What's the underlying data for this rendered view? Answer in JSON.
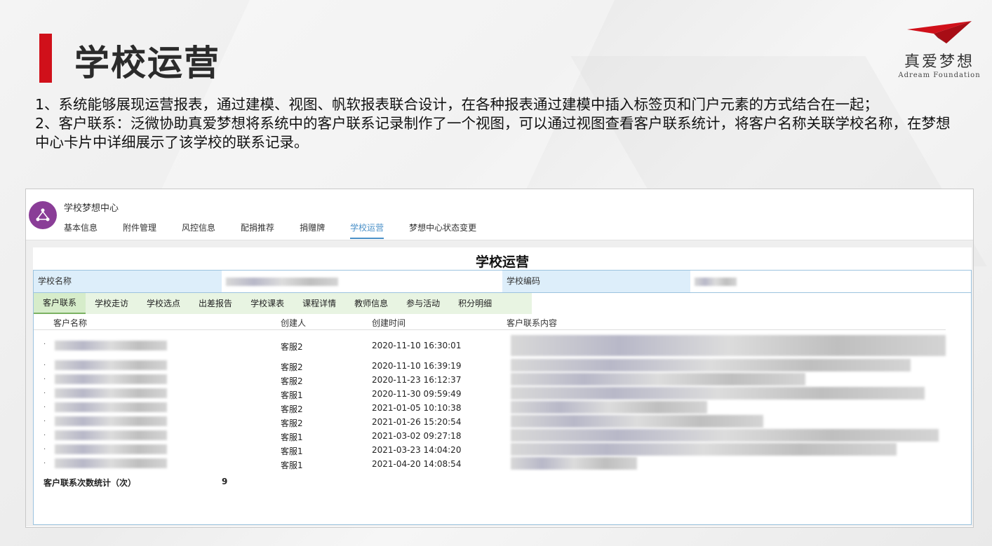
{
  "slide": {
    "title": "学校运营",
    "logo": {
      "cn": "真爱梦想",
      "en": "Adream Foundation"
    },
    "paragraphs": [
      "1、系统能够展现运营报表，通过建模、视图、帆软报表联合设计，在各种报表通过建模中插入标签页和门户元素的方式结合在一起；",
      "2、客户联系：泛微协助真爱梦想将系统中的客户联系记录制作了一个视图，可以通过视图查看客户联系统计，将客户名称关联学校名称，在梦想中心卡片中详细展示了该学校的联系记录。"
    ]
  },
  "app": {
    "title": "学校梦想中心",
    "icon": "share-network-icon",
    "accent": "#8a3d97",
    "nav": [
      "基本信息",
      "附件管理",
      "风控信息",
      "配捐推荐",
      "捐赠牌",
      "学校运营",
      "梦想中心状态变更"
    ],
    "nav_active": "学校运营"
  },
  "card": {
    "title": "学校运营",
    "school_name_label": "学校名称",
    "school_code_label": "学校编码",
    "tabs": [
      "客户联系",
      "学校走访",
      "学校选点",
      "出差报告",
      "学校课表",
      "课程详情",
      "教师信息",
      "参与活动",
      "积分明细"
    ],
    "tab_active": "客户联系",
    "columns": [
      "客户名称",
      "创建人",
      "创建时间",
      "客户联系内容"
    ],
    "rows": [
      {
        "creator": "客服2",
        "time": "2020-11-10 16:30:01"
      },
      {
        "creator": "客服2",
        "time": "2020-11-10 16:39:19"
      },
      {
        "creator": "客服2",
        "time": "2020-11-23 16:12:37"
      },
      {
        "creator": "客服1",
        "time": "2020-11-30 09:59:49"
      },
      {
        "creator": "客服2",
        "time": "2021-01-05 10:10:38"
      },
      {
        "creator": "客服2",
        "time": "2021-01-26 15:20:54"
      },
      {
        "creator": "客服1",
        "time": "2021-03-02 09:27:18"
      },
      {
        "creator": "客服1",
        "time": "2021-03-23 14:04:20"
      },
      {
        "creator": "客服1",
        "time": "2021-04-20 14:08:54"
      }
    ],
    "stat_label": "客户联系次数统计（次）",
    "stat_value": "9"
  },
  "colors": {
    "brand_red": "#d0101a",
    "tab_active": "#4a90c8",
    "tab_green": "#e8f4e2"
  }
}
